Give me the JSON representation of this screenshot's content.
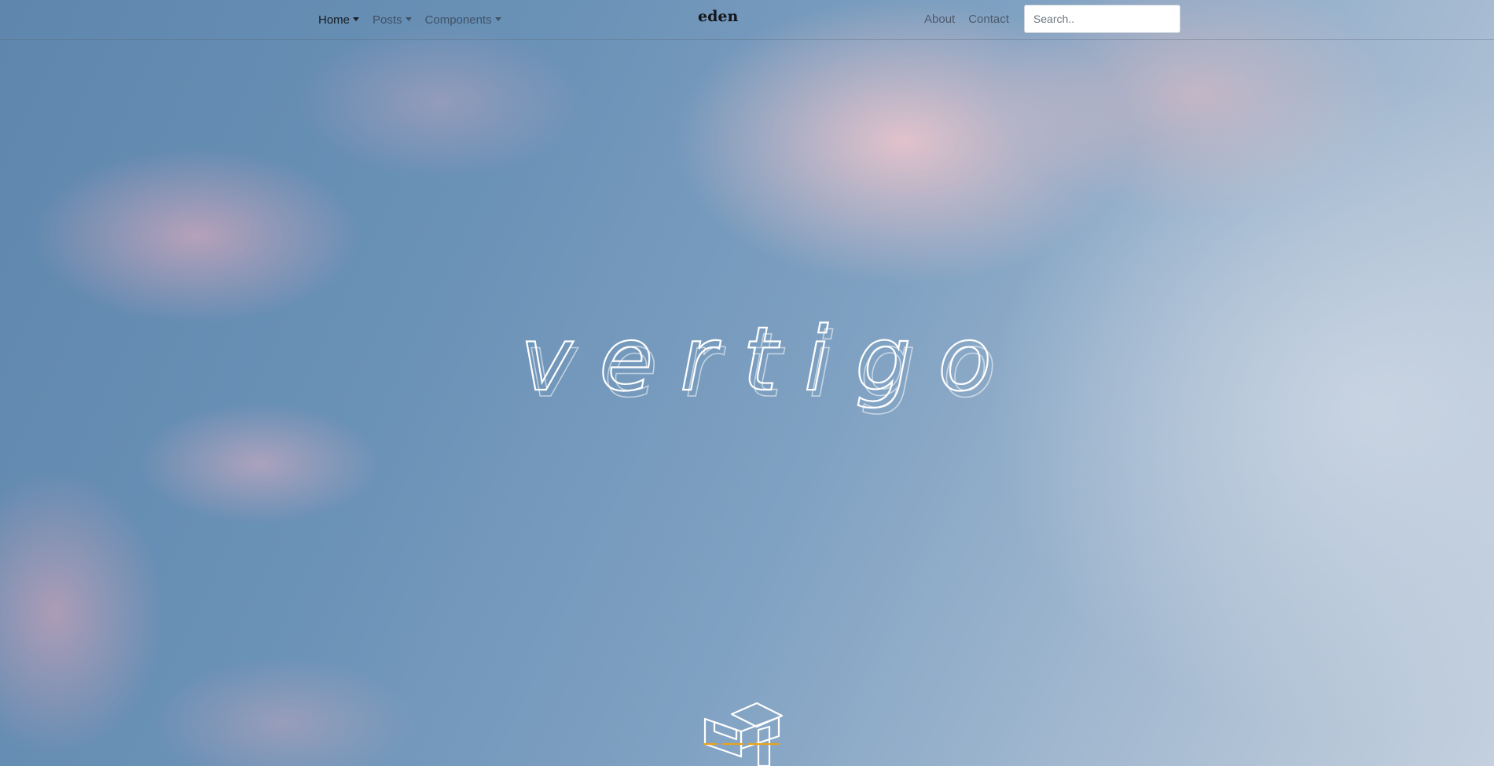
{
  "nav": {
    "left_items": [
      {
        "label": "Home",
        "has_dropdown": true,
        "active": true
      },
      {
        "label": "Posts",
        "has_dropdown": true,
        "active": false
      },
      {
        "label": "Components",
        "has_dropdown": true,
        "active": false
      }
    ],
    "brand": "eden",
    "right_items": [
      {
        "label": "About"
      },
      {
        "label": "Contact"
      }
    ],
    "search": {
      "placeholder": "Search..",
      "value": ""
    }
  },
  "hero": {
    "title": "vertigo"
  },
  "colors": {
    "sky_blue": "#6a91b6",
    "cloud_pink": "#f2c8cd",
    "logo_accent": "#e8a31a"
  },
  "icons": {
    "logo": "isometric-cube-logo-icon"
  }
}
